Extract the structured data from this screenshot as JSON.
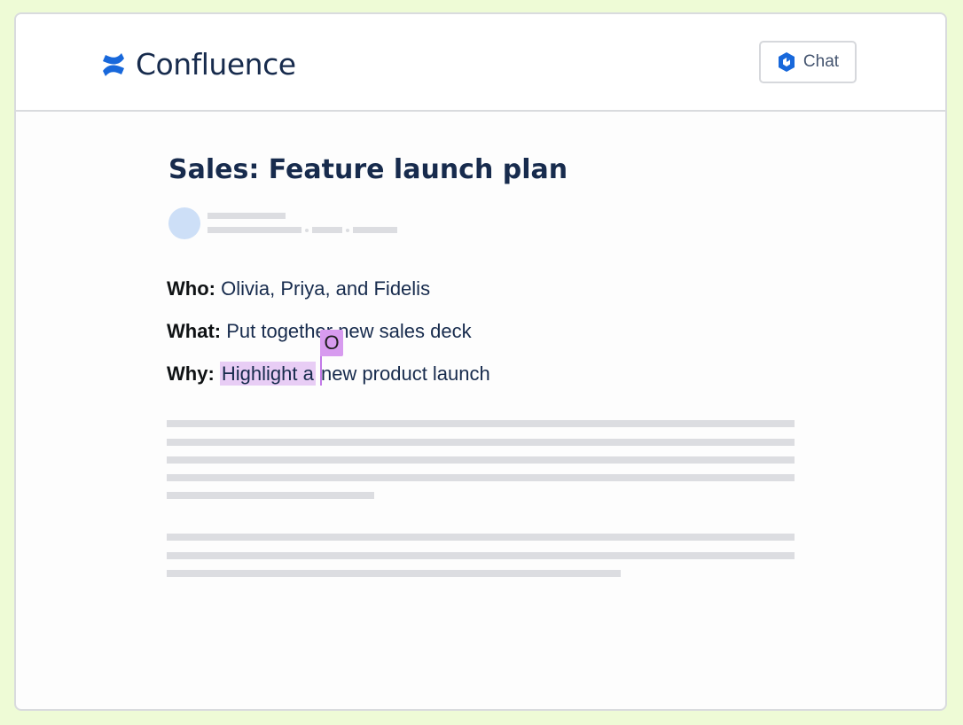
{
  "app": {
    "brand_name": "Confluence",
    "brand_color": "#1868db"
  },
  "header": {
    "chat_label": "Chat"
  },
  "page": {
    "title": "Sales: Feature launch plan",
    "fields": [
      {
        "label": "Who:",
        "value": "Olivia, Priya, and Fidelis"
      },
      {
        "label": "What:",
        "value": "Put together new sales deck"
      },
      {
        "label": "Why:",
        "value_highlighted": "Highlight a",
        "value_rest": " new product launch"
      }
    ]
  },
  "collaborator_cursor": {
    "initial": "O",
    "color": "#d79bef"
  }
}
